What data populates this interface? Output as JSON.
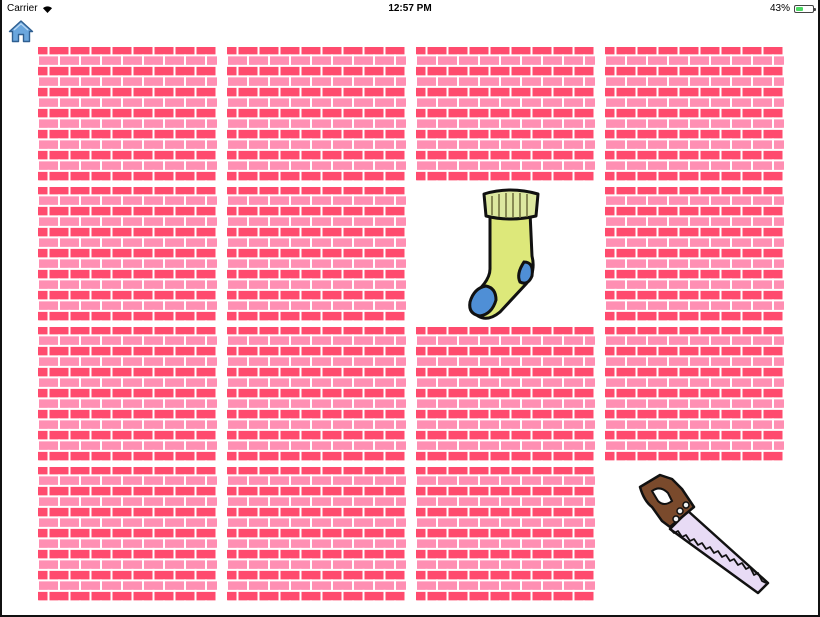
{
  "status_bar": {
    "carrier": "Carrier",
    "time": "12:57 PM",
    "battery": "43%",
    "battery_level": 0.43
  },
  "home_button": {
    "icon": "home-icon"
  },
  "colors": {
    "card_back_light": "#ff8fb3",
    "card_back_dark": "#ff4b6e",
    "card_back_outline": "#ffffff",
    "battery": "#4cd964",
    "home_icon": "#5b9bd5"
  },
  "board": {
    "rows": 4,
    "columns": 4,
    "cards": [
      {
        "state": "face-down"
      },
      {
        "state": "face-down"
      },
      {
        "state": "face-down"
      },
      {
        "state": "face-down"
      },
      {
        "state": "face-down"
      },
      {
        "state": "face-down"
      },
      {
        "state": "face-up",
        "image": "sock"
      },
      {
        "state": "face-down"
      },
      {
        "state": "face-down"
      },
      {
        "state": "face-down"
      },
      {
        "state": "face-down"
      },
      {
        "state": "face-down"
      },
      {
        "state": "face-down"
      },
      {
        "state": "face-down"
      },
      {
        "state": "face-down"
      },
      {
        "state": "face-up",
        "image": "hand-saw"
      }
    ]
  }
}
